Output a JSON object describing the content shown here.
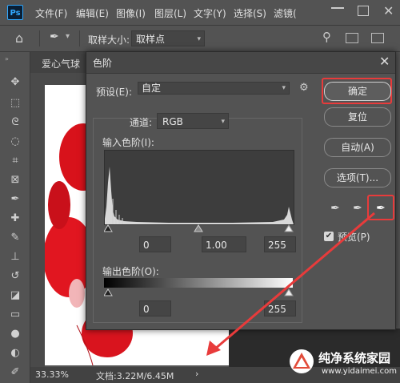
{
  "app": {
    "logo": "Ps"
  },
  "menubar": {
    "items": [
      "文件(F)",
      "编辑(E)",
      "图像(I)",
      "图层(L)",
      "文字(Y)",
      "选择(S)",
      "滤镜("
    ]
  },
  "options_bar": {
    "sample_size_label": "取样大小:",
    "sample_size_value": "取样点"
  },
  "document": {
    "tab_title": "爱心气球",
    "zoom": "33.33%",
    "doc_info": "文档:3.22M/6.45M"
  },
  "dialog": {
    "title": "色阶",
    "preset_label": "预设(E):",
    "preset_value": "自定",
    "channel_label": "通道:",
    "channel_value": "RGB",
    "input_levels_label": "输入色阶(I):",
    "input_black": "0",
    "input_gamma": "1.00",
    "input_white": "255",
    "output_levels_label": "输出色阶(O):",
    "output_black": "0",
    "output_white": "255",
    "buttons": {
      "ok": "确定",
      "reset": "复位",
      "auto": "自动(A)",
      "options": "选项(T)..."
    },
    "preview_label": "预览(P)",
    "preview_checked": true
  },
  "watermark": {
    "title": "纯净系统家园",
    "url": "www.yidaimei.com"
  },
  "colors": {
    "highlight": "#e83b3b",
    "panel": "#535353",
    "accent": "#31a8ff"
  }
}
